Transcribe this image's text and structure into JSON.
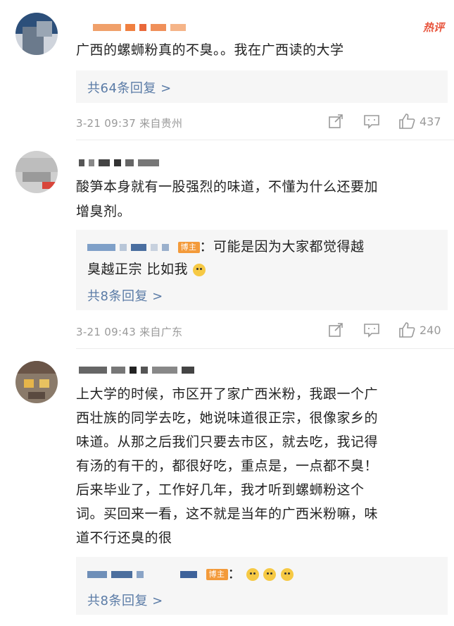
{
  "hot_label": "热评",
  "comments": [
    {
      "text": "广西的螺蛳粉真的不臭。。我在广西读的大学",
      "reply_count_label": "共64条回复 >",
      "meta": "3-21 09:37 来自贵州",
      "likes": "437"
    },
    {
      "text_lines": [
        "酸笋本身就有一股强烈的味道，不懂为什么还要加",
        "增臭剂。"
      ],
      "author_reply": {
        "badge": "博主",
        "text_lines": [
          "：可能是因为大家都觉得越",
          "臭越正宗 比如我"
        ]
      },
      "reply_count_label": "共8条回复 >",
      "meta": "3-21 09:43 来自广东",
      "likes": "240"
    },
    {
      "text_lines": [
        "上大学的时候，市区开了家广西米粉，我跟一个广",
        "西壮族的同学去吃，她说味道很正宗，很像家乡的",
        "味道。从那之后我们只要去市区，就去吃，我记得",
        "有汤的有干的，都很好吃，重点是，一点都不臭！",
        "后来毕业了，工作好几年，我才听到螺蛳粉这个",
        "词。买回来一看，这不就是当年的广西米粉嘛，味",
        "道不行还臭的很"
      ],
      "author_reply": {
        "badge": "博主",
        "text": "："
      },
      "reply_count_label": "共8条回复 >"
    }
  ]
}
